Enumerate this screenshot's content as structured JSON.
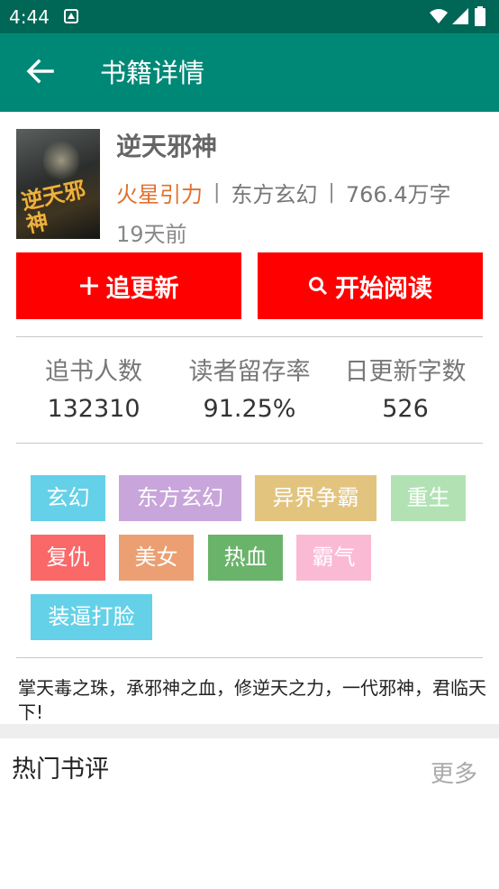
{
  "status_bar": {
    "time": "4:44",
    "icons": [
      "notification-icon",
      "wifi-icon",
      "signal-icon",
      "battery-icon"
    ]
  },
  "toolbar": {
    "back_icon": "arrow-left-icon",
    "title": "书籍详情",
    "background_color": "#008877"
  },
  "book": {
    "cover_text": "逆天邪神",
    "name": "逆天邪神",
    "author": "火星引力",
    "category": "东方玄幻",
    "word_count": "766.4万字",
    "updated": "19天前",
    "separator": "|"
  },
  "actions": {
    "follow_label": "追更新",
    "follow_icon": "plus-icon",
    "read_label": "开始阅读",
    "read_icon": "search-icon",
    "button_color": "#ff0000"
  },
  "stats": [
    {
      "label": "追书人数",
      "value": "132310"
    },
    {
      "label": "读者留存率",
      "value": "91.25%"
    },
    {
      "label": "日更新字数",
      "value": "526"
    }
  ],
  "tags": [
    {
      "label": "玄幻",
      "color": "#64d1e8"
    },
    {
      "label": "东方玄幻",
      "color": "#c8a6db"
    },
    {
      "label": "异界争霸",
      "color": "#e2c47e"
    },
    {
      "label": "重生",
      "color": "#b2e2b4"
    },
    {
      "label": "复仇",
      "color": "#fa6868"
    },
    {
      "label": "美女",
      "color": "#eb9f72"
    },
    {
      "label": "热血",
      "color": "#6ab36a"
    },
    {
      "label": "霸气",
      "color": "#fbbad4"
    },
    {
      "label": "装逼打脸",
      "color": "#64d1e8"
    }
  ],
  "intro": "掌天毒之珠，承邪神之血，修逆天之力，一代邪神，君临天下!",
  "reviews": {
    "title": "热门书评",
    "more": "更多"
  }
}
